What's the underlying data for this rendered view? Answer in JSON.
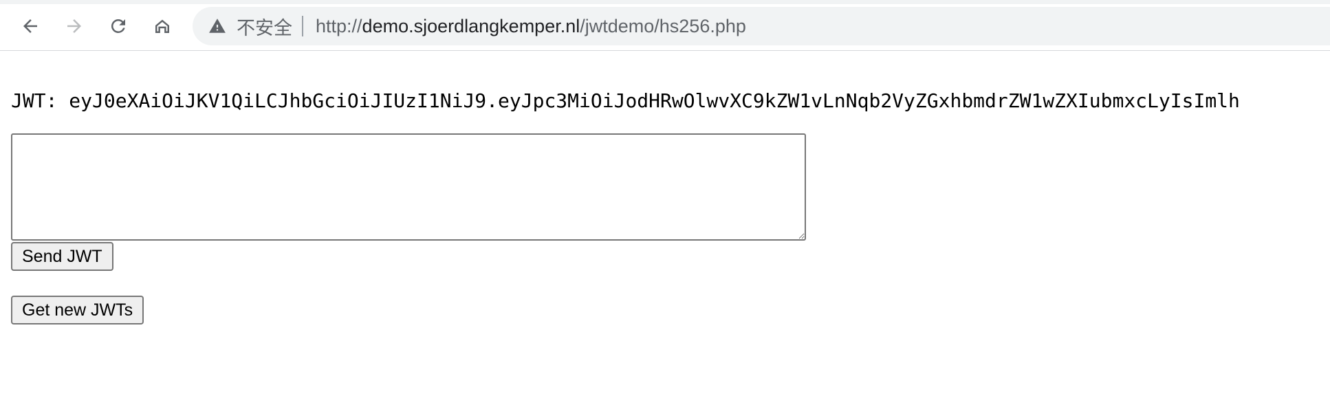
{
  "browser": {
    "security_label": "不安全",
    "url": {
      "scheme": "http://",
      "host": "demo.sjoerdlangkemper.nl",
      "path": "/jwtdemo/hs256.php"
    },
    "icons": {
      "back": "back-arrow-icon",
      "forward": "forward-arrow-icon",
      "reload": "reload-icon",
      "home": "home-icon",
      "warning": "warning-triangle-icon"
    }
  },
  "page": {
    "jwt_label": "JWT:",
    "jwt_value": "eyJ0eXAiOiJKV1QiLCJhbGciOiJIUzI1NiJ9.eyJpc3MiOiJodHRwOlwvXC9kZW1vLnNqb2VyZGxhbmdrZW1wZXIubmxcLyIsImlh",
    "textarea_value": "",
    "send_button_label": "Send JWT",
    "new_button_label": "Get new JWTs"
  },
  "colors": {
    "omnibox_bg": "#f1f3f4",
    "button_bg": "#efefef",
    "button_border": "#767676"
  }
}
